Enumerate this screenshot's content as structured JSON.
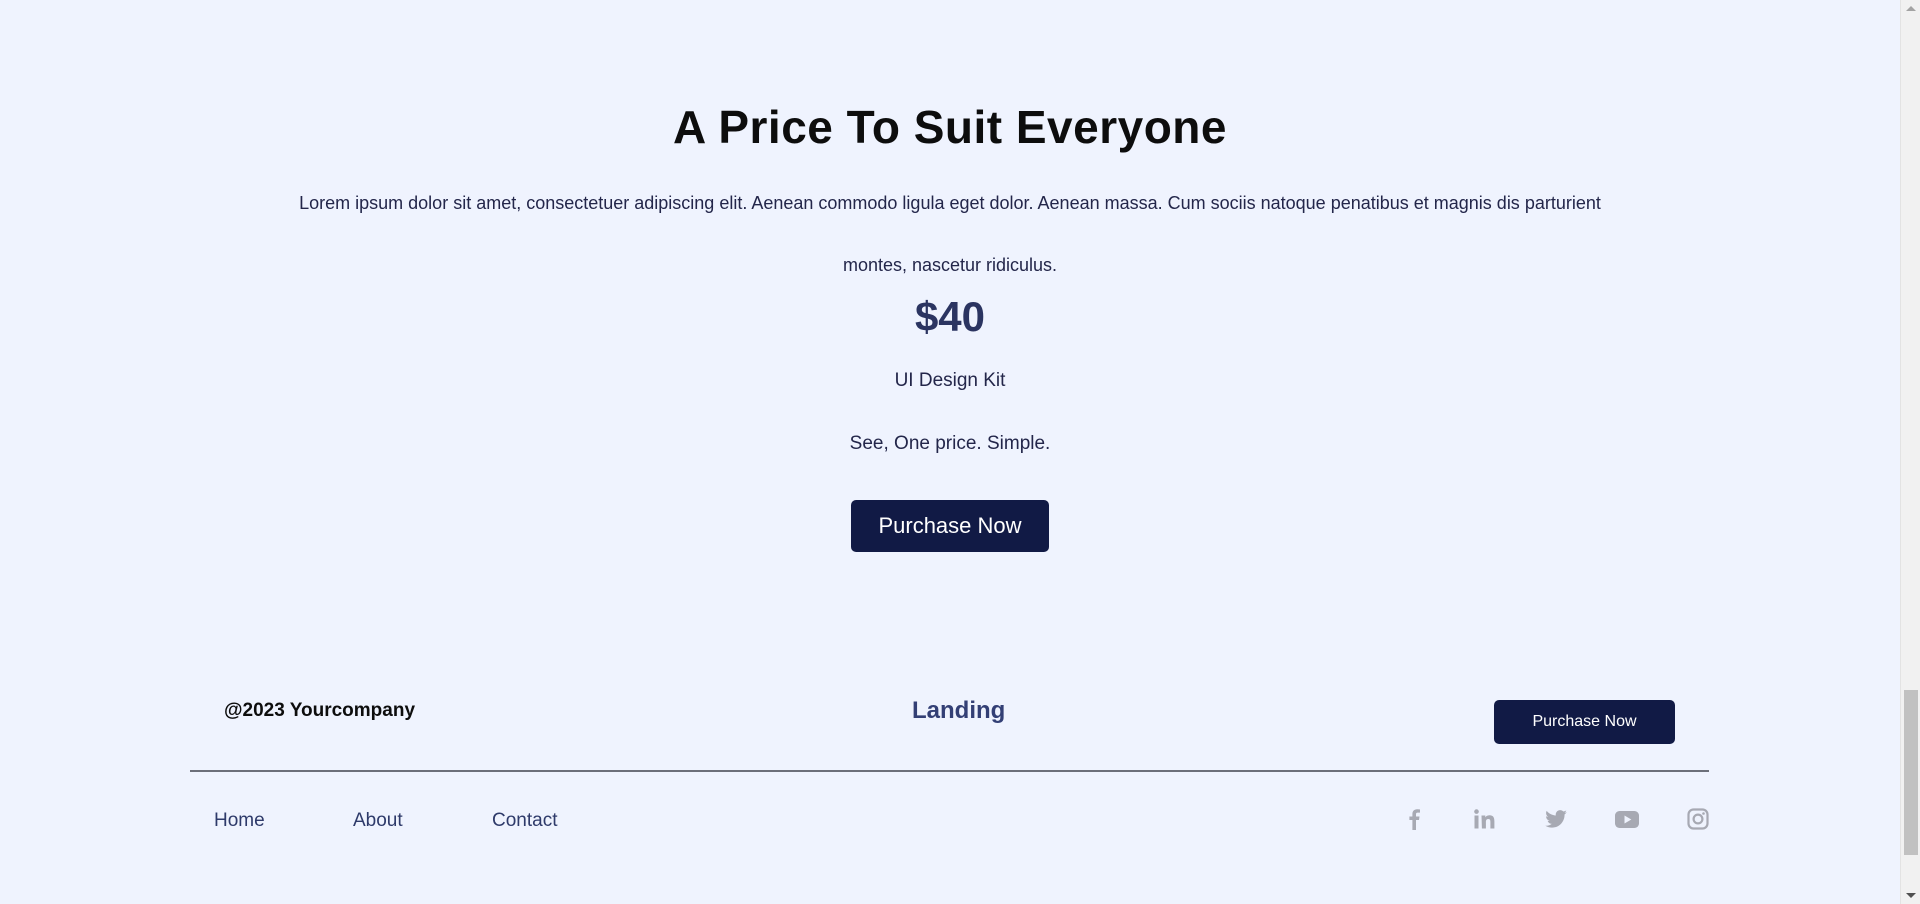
{
  "pricing": {
    "title": "A Price To Suit Everyone",
    "description": "Lorem ipsum dolor sit amet, consectetuer adipiscing elit. Aenean commodo ligula eget dolor. Aenean massa. Cum sociis natoque penatibus et magnis dis parturient montes, nascetur ridiculus.",
    "price": "$40",
    "product": "UI Design Kit",
    "tagline": "See, One price. Simple.",
    "cta_label": "Purchase Now"
  },
  "footer": {
    "copyright": "@2023 Yourcompany",
    "brand": "Landing",
    "cta_label": "Purchase Now",
    "nav": [
      {
        "label": "Home"
      },
      {
        "label": "About"
      },
      {
        "label": "Contact"
      }
    ],
    "social_icons": [
      "facebook-icon",
      "linkedin-icon",
      "twitter-icon",
      "youtube-icon",
      "instagram-icon"
    ]
  },
  "colors": {
    "background": "#eff3fe",
    "accent": "#111a45",
    "brand_text": "#333f75",
    "icon_gray": "#a7a9b3"
  }
}
